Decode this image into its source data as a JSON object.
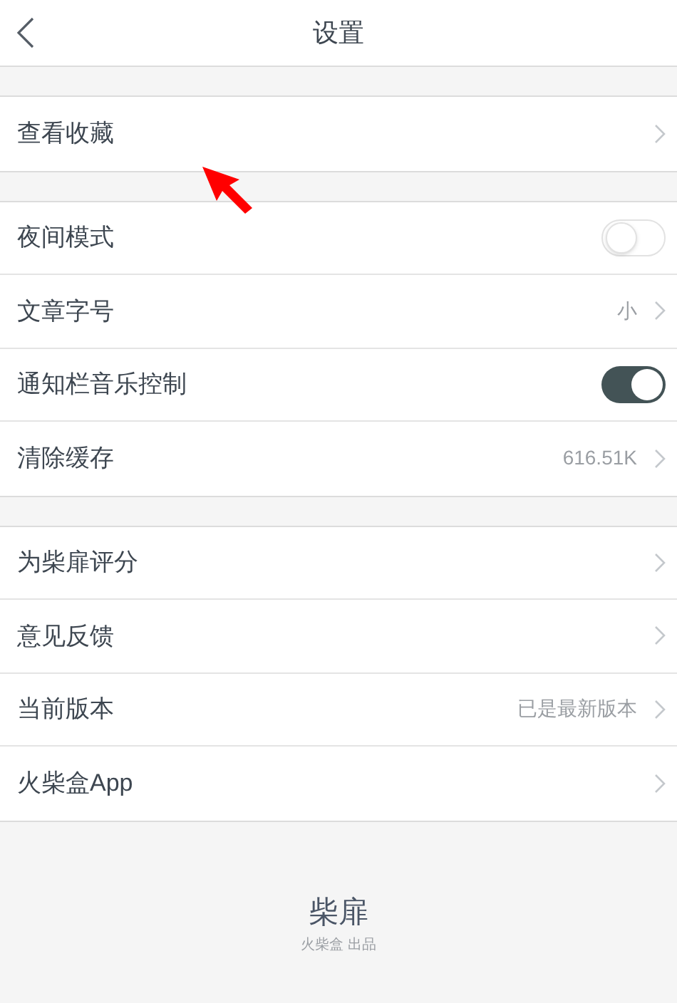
{
  "header": {
    "title": "设置"
  },
  "sections": [
    {
      "items": [
        {
          "kind": "link",
          "label": "查看收藏"
        }
      ]
    },
    {
      "items": [
        {
          "kind": "toggle",
          "label": "夜间模式",
          "on": false
        },
        {
          "kind": "link",
          "label": "文章字号",
          "value": "小"
        },
        {
          "kind": "toggle",
          "label": "通知栏音乐控制",
          "on": true
        },
        {
          "kind": "link",
          "label": "清除缓存",
          "value": "616.51K"
        }
      ]
    },
    {
      "items": [
        {
          "kind": "link",
          "label": "为柴扉评分"
        },
        {
          "kind": "link",
          "label": "意见反馈"
        },
        {
          "kind": "link",
          "label": "当前版本",
          "value": "已是最新版本"
        },
        {
          "kind": "link",
          "label": "火柴盒App"
        }
      ]
    }
  ],
  "footer": {
    "title": "柴扉",
    "subtitle": "火柴盒 出品"
  }
}
